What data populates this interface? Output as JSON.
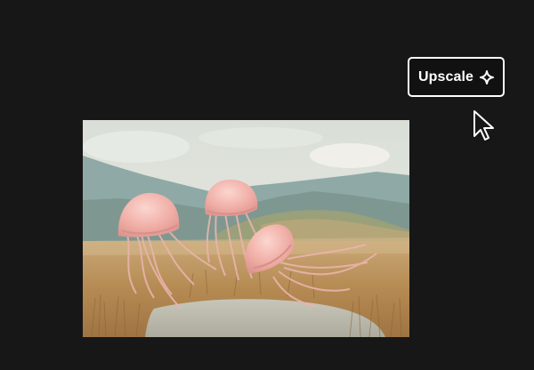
{
  "toolbar": {
    "upscale_label": "Upscale",
    "upscale_icon": "sparkle-icon"
  },
  "cursor": {
    "icon": "pointer-cursor-icon"
  },
  "image": {
    "subject_icon": "jellyfish-in-marsh-image"
  },
  "colors": {
    "background": "#171717",
    "button_border": "#ffffff",
    "button_text": "#ffffff",
    "sky": "#dfe3dc",
    "mountains": "#7f9c9a",
    "grass": "#b88f56",
    "jellyfish": "#f0b3ac"
  }
}
